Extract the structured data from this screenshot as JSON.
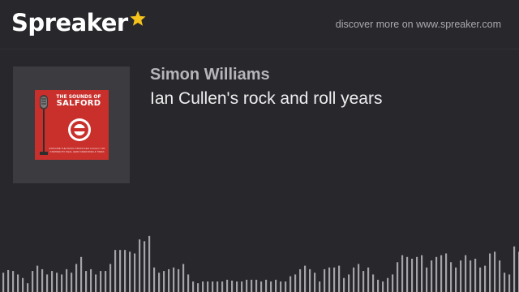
{
  "brand": {
    "name": "Spreaker",
    "accent_color": "#f6c21c",
    "star_icon": "star-icon"
  },
  "header": {
    "discover_link": "discover more on www.spreaker.com"
  },
  "episode": {
    "author": "Simon Williams",
    "title": "Ian Cullen's rock and roll years"
  },
  "cover": {
    "line1": "THE SOUNDS OF",
    "line2": "SALFORD",
    "badge_text": "SALFORD CITY RADIO",
    "subtext": "EXPLORE THE MUSIC PRODUCED LOCALLY OR INSPIRED BY REAL HERO MEMORIES & TIMES",
    "background_color": "#c9302c"
  },
  "waveform": {
    "color": "#a3a3a8",
    "levels": [
      0.22,
      0.25,
      0.24,
      0.2,
      0.16,
      0.1,
      0.24,
      0.3,
      0.26,
      0.2,
      0.24,
      0.22,
      0.2,
      0.26,
      0.22,
      0.32,
      0.4,
      0.24,
      0.26,
      0.2,
      0.24,
      0.24,
      0.32,
      0.48,
      0.48,
      0.48,
      0.46,
      0.44,
      0.6,
      0.58,
      0.64,
      0.28,
      0.22,
      0.24,
      0.26,
      0.28,
      0.26,
      0.32,
      0.2,
      0.12,
      0.1,
      0.12,
      0.12,
      0.12,
      0.12,
      0.12,
      0.14,
      0.13,
      0.12,
      0.12,
      0.14,
      0.14,
      0.14,
      0.12,
      0.14,
      0.12,
      0.14,
      0.12,
      0.12,
      0.18,
      0.2,
      0.26,
      0.3,
      0.26,
      0.22,
      0.12,
      0.26,
      0.28,
      0.28,
      0.3,
      0.16,
      0.2,
      0.28,
      0.32,
      0.24,
      0.28,
      0.2,
      0.14,
      0.12,
      0.16,
      0.2,
      0.34,
      0.42,
      0.4,
      0.38,
      0.4,
      0.42,
      0.28,
      0.36,
      0.4,
      0.42,
      0.44,
      0.34,
      0.28,
      0.36,
      0.42,
      0.36,
      0.38,
      0.28,
      0.3,
      0.44,
      0.46,
      0.36,
      0.22,
      0.2,
      0.52,
      0.46,
      0.52,
      0.56
    ]
  }
}
